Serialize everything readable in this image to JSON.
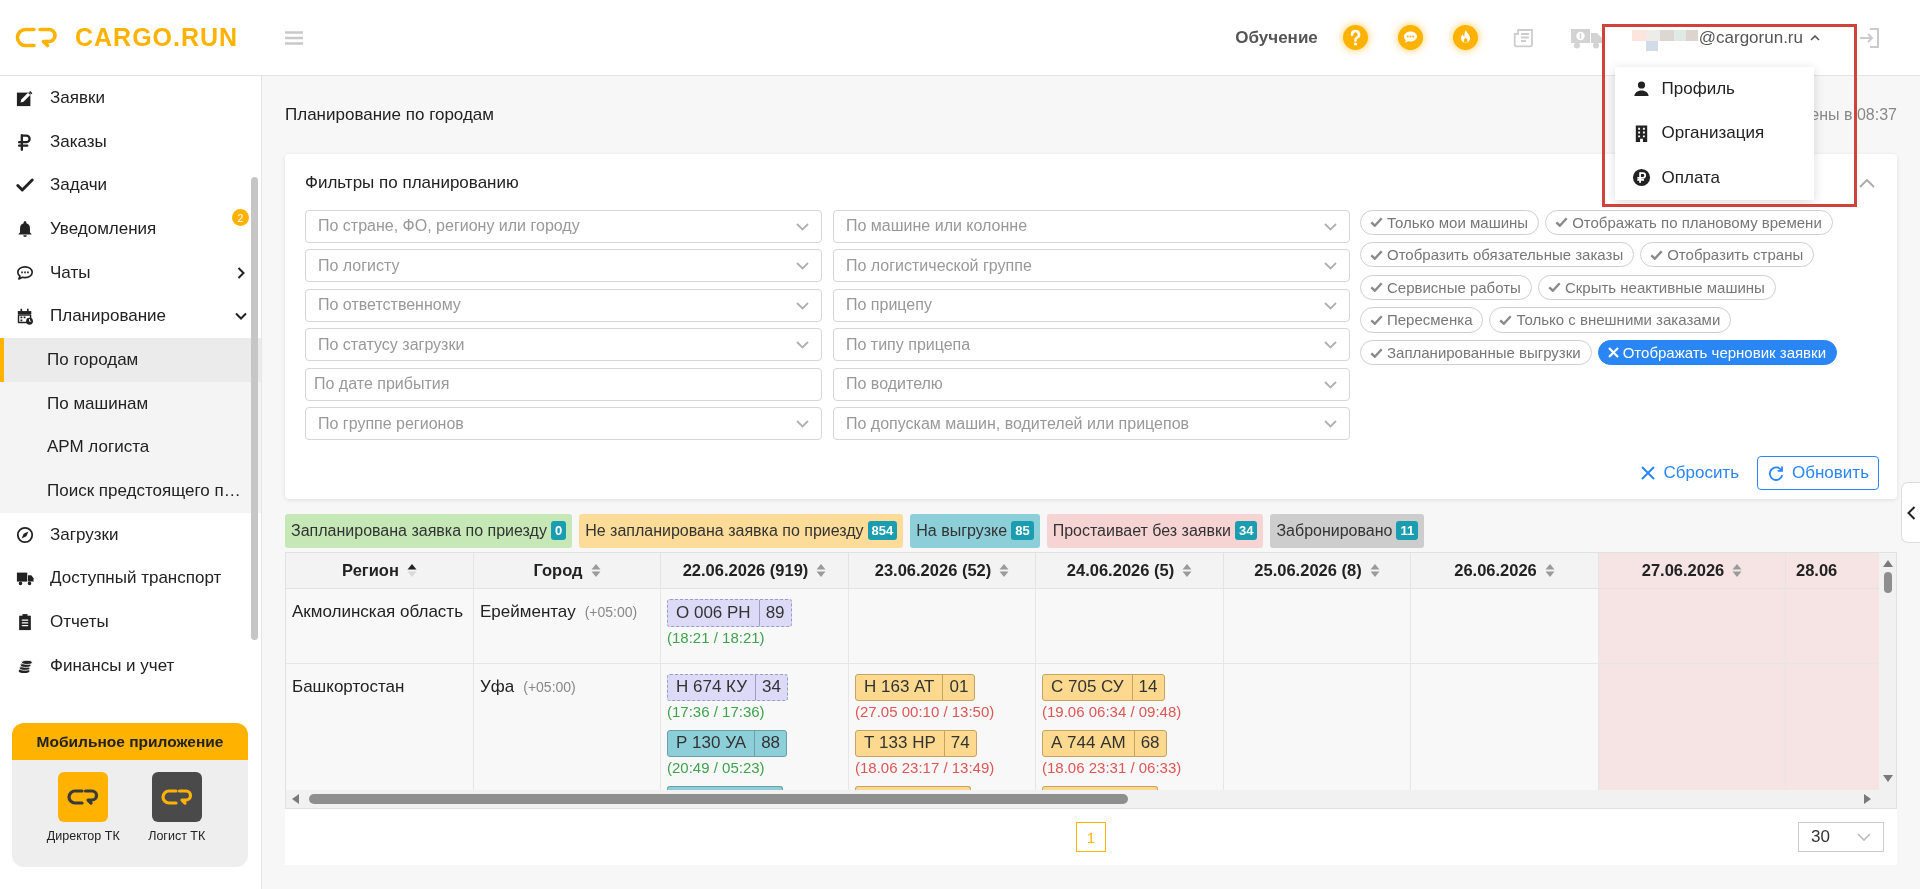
{
  "header": {
    "logo": "CARGO.RUN",
    "training": "Обучение",
    "user_email": "@cargorun.ru"
  },
  "user_menu": {
    "open": true,
    "items": [
      {
        "label": "Профиль"
      },
      {
        "label": "Организация"
      },
      {
        "label": "Оплата"
      }
    ]
  },
  "sidebar": {
    "items": [
      {
        "label": "Заявки",
        "selected": false
      },
      {
        "label": "Заказы",
        "selected": false
      },
      {
        "label": "Задачи",
        "selected": false
      },
      {
        "label": "Уведомления",
        "selected": false,
        "badge": "2"
      },
      {
        "label": "Чаты",
        "selected": false,
        "expanded": false
      },
      {
        "label": "Планирование",
        "selected": false,
        "expanded": true,
        "children": [
          {
            "label": "По городам",
            "selected": true
          },
          {
            "label": "По машинам",
            "selected": false
          },
          {
            "label": "АРМ логиста",
            "selected": false
          },
          {
            "label": "Поиск предстоящего п…",
            "selected": false
          }
        ]
      },
      {
        "label": "Загрузки",
        "selected": false
      },
      {
        "label": "Доступный транспорт",
        "selected": false
      },
      {
        "label": "Отчеты",
        "selected": false
      },
      {
        "label": "Финансы и учет",
        "selected": false
      }
    ]
  },
  "mobile_app": {
    "title": "Мобильное приложение",
    "apps": [
      {
        "label": "Директор ТК",
        "color": "#ffb300"
      },
      {
        "label": "Логист ТК",
        "color": "#4a4a4a"
      }
    ]
  },
  "page": {
    "title": "Планирование по городам",
    "updated_text": "ены в 08:37"
  },
  "filters": {
    "title": "Фильтры по планированию",
    "expanded": true,
    "fields": [
      {
        "placeholder": "По стране, ФО, региону или городу",
        "kind": "select"
      },
      {
        "placeholder": "По машине или колонне",
        "kind": "select"
      },
      {
        "placeholder": "По логисту",
        "kind": "select"
      },
      {
        "placeholder": "По логистической группе",
        "kind": "select"
      },
      {
        "placeholder": "По ответственному",
        "kind": "select"
      },
      {
        "placeholder": "По прицепу",
        "kind": "select"
      },
      {
        "placeholder": "По статусу загрузки",
        "kind": "select"
      },
      {
        "placeholder": "По типу прицепа",
        "kind": "select"
      },
      {
        "placeholder": "По дате прибытия",
        "kind": "date"
      },
      {
        "placeholder": "По водителю",
        "kind": "select"
      },
      {
        "placeholder": "По группе регионов",
        "kind": "select"
      },
      {
        "placeholder": "По допускам машин, водителей или прицепов",
        "kind": "select"
      }
    ],
    "toggle_rows": [
      [
        {
          "label": "Только мои машины",
          "on": false
        },
        {
          "label": "Отображать по плановому времени",
          "on": false
        }
      ],
      [
        {
          "label": "Отобразить обязательные заказы",
          "on": false
        },
        {
          "label": "Отобразить страны",
          "on": false
        }
      ],
      [
        {
          "label": "Сервисные работы",
          "on": false
        },
        {
          "label": "Скрыть неактивные машины",
          "on": false
        }
      ],
      [
        {
          "label": "Пересменка",
          "on": false
        },
        {
          "label": "Только с внешними заказами",
          "on": false
        }
      ],
      [
        {
          "label": "Запланированные выгрузки",
          "on": false
        },
        {
          "label": "Отображать черновик заявки",
          "on": true
        }
      ]
    ],
    "reset_label": "Сбросить",
    "refresh_label": "Обновить"
  },
  "legend": [
    {
      "label": "Запланирована заявка по приезду",
      "count": "0",
      "color": "#c6e8b6"
    },
    {
      "label": "Не запланирована заявка по приезду",
      "count": "854",
      "color": "#fcdc98"
    },
    {
      "label": "На выгрузке",
      "count": "85",
      "color": "#8ccfd9"
    },
    {
      "label": "Простаивает без заявки",
      "count": "34",
      "color": "#f6d4d4"
    },
    {
      "label": "Забронировано",
      "count": "11",
      "color": "#cdcdcd"
    }
  ],
  "table": {
    "columns": [
      {
        "label": "Регион",
        "sorted": true
      },
      {
        "label": "Город",
        "sorted": false
      },
      {
        "label": "22.06.2026 (919)",
        "sorted": false,
        "weekend": false
      },
      {
        "label": "23.06.2026 (52)",
        "sorted": false,
        "weekend": false
      },
      {
        "label": "24.06.2026 (5)",
        "sorted": false,
        "weekend": false
      },
      {
        "label": "25.06.2026 (8)",
        "sorted": false,
        "weekend": false
      },
      {
        "label": "26.06.2026",
        "sorted": false,
        "weekend": false
      },
      {
        "label": "27.06.2026",
        "sorted": false,
        "weekend": true
      },
      {
        "label": "28.06",
        "weekend": true
      }
    ],
    "rows": [
      {
        "region": "Акмолинская область",
        "city": "Ерейментау",
        "timezone": "(+05:00)",
        "days": [
          [
            {
              "plate": "О 006 РН",
              "number": "89",
              "kind": "draft",
              "time": "(18:21 / 18:21)",
              "late": false
            }
          ]
        ]
      },
      {
        "region": "Башкортостан",
        "city": "Уфа",
        "timezone": "(+05:00)",
        "days": [
          [
            {
              "plate": "Н 674 КУ",
              "number": "34",
              "kind": "draft",
              "time": "(17:36 / 17:36)",
              "late": false
            },
            {
              "plate": "Р 130 УА",
              "number": "88",
              "kind": "unloading",
              "time": "(20:49 / 05:23)",
              "late": false
            },
            {
              "kind": "unloading"
            }
          ],
          [
            {
              "plate": "Н 163 АТ",
              "number": "01",
              "kind": "unplanned",
              "time": "(27.05 00:10 / 13:50)",
              "late": true
            },
            {
              "plate": "Т 133 НР",
              "number": "74",
              "kind": "unplanned",
              "time": "(18.06 23:17 / 13:49)",
              "late": true
            },
            {
              "kind": "unplanned"
            }
          ],
          [
            {
              "plate": "С 705 СУ",
              "number": "14",
              "kind": "unplanned",
              "time": "(19.06 06:34 / 09:48)",
              "late": true
            },
            {
              "plate": "А 744 АМ",
              "number": "68",
              "kind": "unplanned",
              "time": "(18.06 23:31 / 06:33)",
              "late": true
            },
            {
              "kind": "unplanned"
            }
          ]
        ]
      }
    ]
  },
  "pagination": {
    "pages": [
      {
        "label": "1",
        "selected": true
      }
    ],
    "page_size": "30"
  }
}
